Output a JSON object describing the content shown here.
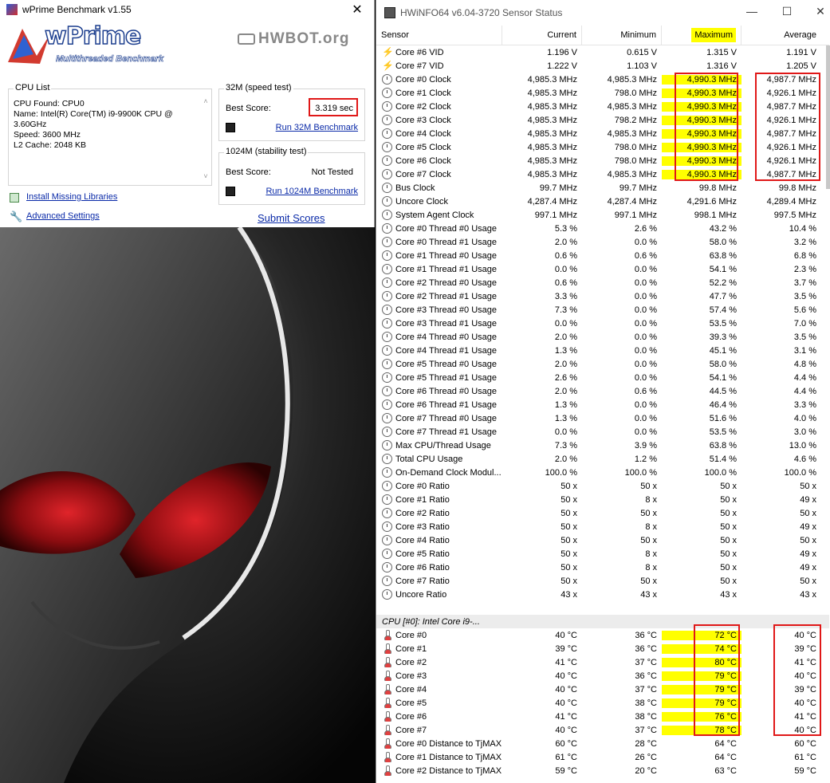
{
  "wprime": {
    "title": "wPrime Benchmark v1.55",
    "logo_text": "wPrime",
    "logo_sub": "Multithreaded Benchmark",
    "hwbot_text": "HWBOT.org",
    "cpu_list_label": "CPU List",
    "cpu_found": "CPU Found: CPU0",
    "cpu_name": "Name:    Intel(R) Core(TM) i9-9900K CPU @ 3.60GHz",
    "cpu_speed": "Speed:    3600 MHz",
    "cpu_l2": "L2 Cache: 2048 KB",
    "speed_test_label": "32M (speed test)",
    "best_score_label": "Best Score:",
    "best_score_32m": "3.319 sec",
    "run_32m": "Run 32M Benchmark",
    "stability_test_label": "1024M (stability test)",
    "best_score_1024m": "Not Tested",
    "run_1024m": "Run 1024M Benchmark",
    "install_libraries": "Install Missing Libraries",
    "advanced_settings": "Advanced Settings",
    "submit_scores": "Submit Scores"
  },
  "hwinfo": {
    "title": "HWiNFO64 v6.04-3720 Sensor Status",
    "columns": [
      "Sensor",
      "Current",
      "Minimum",
      "Maximum",
      "Average"
    ],
    "rows": [
      {
        "icon": "bolt-icon",
        "n": "Core #6 VID",
        "c": "1.196 V",
        "mi": "0.615 V",
        "ma": "1.315 V",
        "av": "1.191 V"
      },
      {
        "icon": "bolt-icon",
        "n": "Core #7 VID",
        "c": "1.222 V",
        "mi": "1.103 V",
        "ma": "1.316 V",
        "av": "1.205 V"
      },
      {
        "icon": "clock-icon",
        "n": "Core #0 Clock",
        "c": "4,985.3 MHz",
        "mi": "4,985.3 MHz",
        "ma": "4,990.3 MHz",
        "av": "4,987.7 MHz"
      },
      {
        "icon": "clock-icon",
        "n": "Core #1 Clock",
        "c": "4,985.3 MHz",
        "mi": "798.0 MHz",
        "ma": "4,990.3 MHz",
        "av": "4,926.1 MHz"
      },
      {
        "icon": "clock-icon",
        "n": "Core #2 Clock",
        "c": "4,985.3 MHz",
        "mi": "4,985.3 MHz",
        "ma": "4,990.3 MHz",
        "av": "4,987.7 MHz"
      },
      {
        "icon": "clock-icon",
        "n": "Core #3 Clock",
        "c": "4,985.3 MHz",
        "mi": "798.2 MHz",
        "ma": "4,990.3 MHz",
        "av": "4,926.1 MHz"
      },
      {
        "icon": "clock-icon",
        "n": "Core #4 Clock",
        "c": "4,985.3 MHz",
        "mi": "4,985.3 MHz",
        "ma": "4,990.3 MHz",
        "av": "4,987.7 MHz"
      },
      {
        "icon": "clock-icon",
        "n": "Core #5 Clock",
        "c": "4,985.3 MHz",
        "mi": "798.0 MHz",
        "ma": "4,990.3 MHz",
        "av": "4,926.1 MHz"
      },
      {
        "icon": "clock-icon",
        "n": "Core #6 Clock",
        "c": "4,985.3 MHz",
        "mi": "798.0 MHz",
        "ma": "4,990.3 MHz",
        "av": "4,926.1 MHz"
      },
      {
        "icon": "clock-icon",
        "n": "Core #7 Clock",
        "c": "4,985.3 MHz",
        "mi": "4,985.3 MHz",
        "ma": "4,990.3 MHz",
        "av": "4,987.7 MHz"
      },
      {
        "icon": "clock-icon",
        "n": "Bus Clock",
        "c": "99.7 MHz",
        "mi": "99.7 MHz",
        "ma": "99.8 MHz",
        "av": "99.8 MHz"
      },
      {
        "icon": "clock-icon",
        "n": "Uncore Clock",
        "c": "4,287.4 MHz",
        "mi": "4,287.4 MHz",
        "ma": "4,291.6 MHz",
        "av": "4,289.4 MHz"
      },
      {
        "icon": "clock-icon",
        "n": "System Agent Clock",
        "c": "997.1 MHz",
        "mi": "997.1 MHz",
        "ma": "998.1 MHz",
        "av": "997.5 MHz"
      },
      {
        "icon": "clock-icon",
        "n": "Core #0 Thread #0 Usage",
        "c": "5.3 %",
        "mi": "2.6 %",
        "ma": "43.2 %",
        "av": "10.4 %"
      },
      {
        "icon": "clock-icon",
        "n": "Core #0 Thread #1 Usage",
        "c": "2.0 %",
        "mi": "0.0 %",
        "ma": "58.0 %",
        "av": "3.2 %"
      },
      {
        "icon": "clock-icon",
        "n": "Core #1 Thread #0 Usage",
        "c": "0.6 %",
        "mi": "0.6 %",
        "ma": "63.8 %",
        "av": "6.8 %"
      },
      {
        "icon": "clock-icon",
        "n": "Core #1 Thread #1 Usage",
        "c": "0.0 %",
        "mi": "0.0 %",
        "ma": "54.1 %",
        "av": "2.3 %"
      },
      {
        "icon": "clock-icon",
        "n": "Core #2 Thread #0 Usage",
        "c": "0.6 %",
        "mi": "0.0 %",
        "ma": "52.2 %",
        "av": "3.7 %"
      },
      {
        "icon": "clock-icon",
        "n": "Core #2 Thread #1 Usage",
        "c": "3.3 %",
        "mi": "0.0 %",
        "ma": "47.7 %",
        "av": "3.5 %"
      },
      {
        "icon": "clock-icon",
        "n": "Core #3 Thread #0 Usage",
        "c": "7.3 %",
        "mi": "0.0 %",
        "ma": "57.4 %",
        "av": "5.6 %"
      },
      {
        "icon": "clock-icon",
        "n": "Core #3 Thread #1 Usage",
        "c": "0.0 %",
        "mi": "0.0 %",
        "ma": "53.5 %",
        "av": "7.0 %"
      },
      {
        "icon": "clock-icon",
        "n": "Core #4 Thread #0 Usage",
        "c": "2.0 %",
        "mi": "0.0 %",
        "ma": "39.3 %",
        "av": "3.5 %"
      },
      {
        "icon": "clock-icon",
        "n": "Core #4 Thread #1 Usage",
        "c": "1.3 %",
        "mi": "0.0 %",
        "ma": "45.1 %",
        "av": "3.1 %"
      },
      {
        "icon": "clock-icon",
        "n": "Core #5 Thread #0 Usage",
        "c": "2.0 %",
        "mi": "0.0 %",
        "ma": "58.0 %",
        "av": "4.8 %"
      },
      {
        "icon": "clock-icon",
        "n": "Core #5 Thread #1 Usage",
        "c": "2.6 %",
        "mi": "0.0 %",
        "ma": "54.1 %",
        "av": "4.4 %"
      },
      {
        "icon": "clock-icon",
        "n": "Core #6 Thread #0 Usage",
        "c": "2.0 %",
        "mi": "0.6 %",
        "ma": "44.5 %",
        "av": "4.4 %"
      },
      {
        "icon": "clock-icon",
        "n": "Core #6 Thread #1 Usage",
        "c": "1.3 %",
        "mi": "0.0 %",
        "ma": "46.4 %",
        "av": "3.3 %"
      },
      {
        "icon": "clock-icon",
        "n": "Core #7 Thread #0 Usage",
        "c": "1.3 %",
        "mi": "0.0 %",
        "ma": "51.6 %",
        "av": "4.0 %"
      },
      {
        "icon": "clock-icon",
        "n": "Core #7 Thread #1 Usage",
        "c": "0.0 %",
        "mi": "0.0 %",
        "ma": "53.5 %",
        "av": "3.0 %"
      },
      {
        "icon": "clock-icon",
        "n": "Max CPU/Thread Usage",
        "c": "7.3 %",
        "mi": "3.9 %",
        "ma": "63.8 %",
        "av": "13.0 %"
      },
      {
        "icon": "clock-icon",
        "n": "Total CPU Usage",
        "c": "2.0 %",
        "mi": "1.2 %",
        "ma": "51.4 %",
        "av": "4.6 %"
      },
      {
        "icon": "clock-icon",
        "n": "On-Demand Clock Modul...",
        "c": "100.0 %",
        "mi": "100.0 %",
        "ma": "100.0 %",
        "av": "100.0 %"
      },
      {
        "icon": "clock-icon",
        "n": "Core #0 Ratio",
        "c": "50 x",
        "mi": "50 x",
        "ma": "50 x",
        "av": "50 x"
      },
      {
        "icon": "clock-icon",
        "n": "Core #1 Ratio",
        "c": "50 x",
        "mi": "8 x",
        "ma": "50 x",
        "av": "49 x"
      },
      {
        "icon": "clock-icon",
        "n": "Core #2 Ratio",
        "c": "50 x",
        "mi": "50 x",
        "ma": "50 x",
        "av": "50 x"
      },
      {
        "icon": "clock-icon",
        "n": "Core #3 Ratio",
        "c": "50 x",
        "mi": "8 x",
        "ma": "50 x",
        "av": "49 x"
      },
      {
        "icon": "clock-icon",
        "n": "Core #4 Ratio",
        "c": "50 x",
        "mi": "50 x",
        "ma": "50 x",
        "av": "50 x"
      },
      {
        "icon": "clock-icon",
        "n": "Core #5 Ratio",
        "c": "50 x",
        "mi": "8 x",
        "ma": "50 x",
        "av": "49 x"
      },
      {
        "icon": "clock-icon",
        "n": "Core #6 Ratio",
        "c": "50 x",
        "mi": "8 x",
        "ma": "50 x",
        "av": "49 x"
      },
      {
        "icon": "clock-icon",
        "n": "Core #7 Ratio",
        "c": "50 x",
        "mi": "50 x",
        "ma": "50 x",
        "av": "50 x"
      },
      {
        "icon": "clock-icon",
        "n": "Uncore Ratio",
        "c": "43 x",
        "mi": "43 x",
        "ma": "43 x",
        "av": "43 x"
      }
    ],
    "section_label": "CPU [#0]: Intel Core i9-...",
    "temp_rows": [
      {
        "icon": "thermometer-icon",
        "n": "Core #0",
        "c": "40 °C",
        "mi": "36 °C",
        "ma": "72 °C",
        "av": "40 °C"
      },
      {
        "icon": "thermometer-icon",
        "n": "Core #1",
        "c": "39 °C",
        "mi": "36 °C",
        "ma": "74 °C",
        "av": "39 °C"
      },
      {
        "icon": "thermometer-icon",
        "n": "Core #2",
        "c": "41 °C",
        "mi": "37 °C",
        "ma": "80 °C",
        "av": "41 °C"
      },
      {
        "icon": "thermometer-icon",
        "n": "Core #3",
        "c": "40 °C",
        "mi": "36 °C",
        "ma": "79 °C",
        "av": "40 °C"
      },
      {
        "icon": "thermometer-icon",
        "n": "Core #4",
        "c": "40 °C",
        "mi": "37 °C",
        "ma": "79 °C",
        "av": "39 °C"
      },
      {
        "icon": "thermometer-icon",
        "n": "Core #5",
        "c": "40 °C",
        "mi": "38 °C",
        "ma": "79 °C",
        "av": "40 °C"
      },
      {
        "icon": "thermometer-icon",
        "n": "Core #6",
        "c": "41 °C",
        "mi": "38 °C",
        "ma": "76 °C",
        "av": "41 °C"
      },
      {
        "icon": "thermometer-icon",
        "n": "Core #7",
        "c": "40 °C",
        "mi": "37 °C",
        "ma": "78 °C",
        "av": "40 °C"
      },
      {
        "icon": "thermometer-icon",
        "n": "Core #0 Distance to TjMAX",
        "c": "60 °C",
        "mi": "28 °C",
        "ma": "64 °C",
        "av": "60 °C"
      },
      {
        "icon": "thermometer-icon",
        "n": "Core #1 Distance to TjMAX",
        "c": "61 °C",
        "mi": "26 °C",
        "ma": "64 °C",
        "av": "61 °C"
      },
      {
        "icon": "thermometer-icon",
        "n": "Core #2 Distance to TjMAX",
        "c": "59 °C",
        "mi": "20 °C",
        "ma": "63 °C",
        "av": "59 °C"
      }
    ]
  },
  "colors": {
    "highlight": "#ffff00",
    "annotation_box": "#e01818",
    "link": "#0a2aa8"
  }
}
